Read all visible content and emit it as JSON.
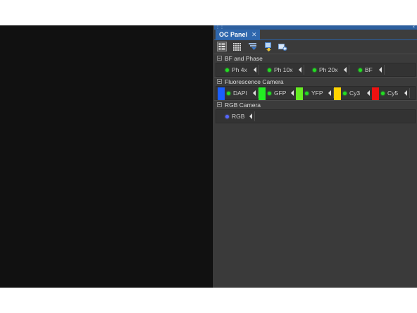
{
  "panel": {
    "tab_title": "OC Panel",
    "tab_close": "✕",
    "title_bar_close": "×"
  },
  "toolbar": {
    "icons": [
      "list-view-icon",
      "grid-view-icon",
      "filter-icon",
      "export-icon",
      "add-config-icon"
    ]
  },
  "sections": [
    {
      "name": "BF and Phase",
      "configs": [
        {
          "label": "Ph 4x",
          "indicator": "#22dd22"
        },
        {
          "label": "Ph 10x",
          "indicator": "#22dd22"
        },
        {
          "label": "Ph 20x",
          "indicator": "#22dd22"
        },
        {
          "label": "BF",
          "indicator": "#22dd22"
        }
      ]
    },
    {
      "name": "Fluorescence Camera",
      "configs": [
        {
          "label": "DAPI",
          "color": "#1a5fff",
          "indicator": "#22dd22"
        },
        {
          "label": "GFP",
          "color": "#22ee22",
          "indicator": "#22dd22"
        },
        {
          "label": "YFP",
          "color": "#66ee22",
          "indicator": "#22dd22"
        },
        {
          "label": "Cy3",
          "color": "#ffd400",
          "indicator": "#22dd22"
        },
        {
          "label": "Cy5",
          "color": "#ee1111",
          "indicator": "#22dd22"
        }
      ]
    },
    {
      "name": "RGB Camera",
      "configs": [
        {
          "label": "RGB",
          "indicator": "#5566ff"
        }
      ]
    }
  ]
}
